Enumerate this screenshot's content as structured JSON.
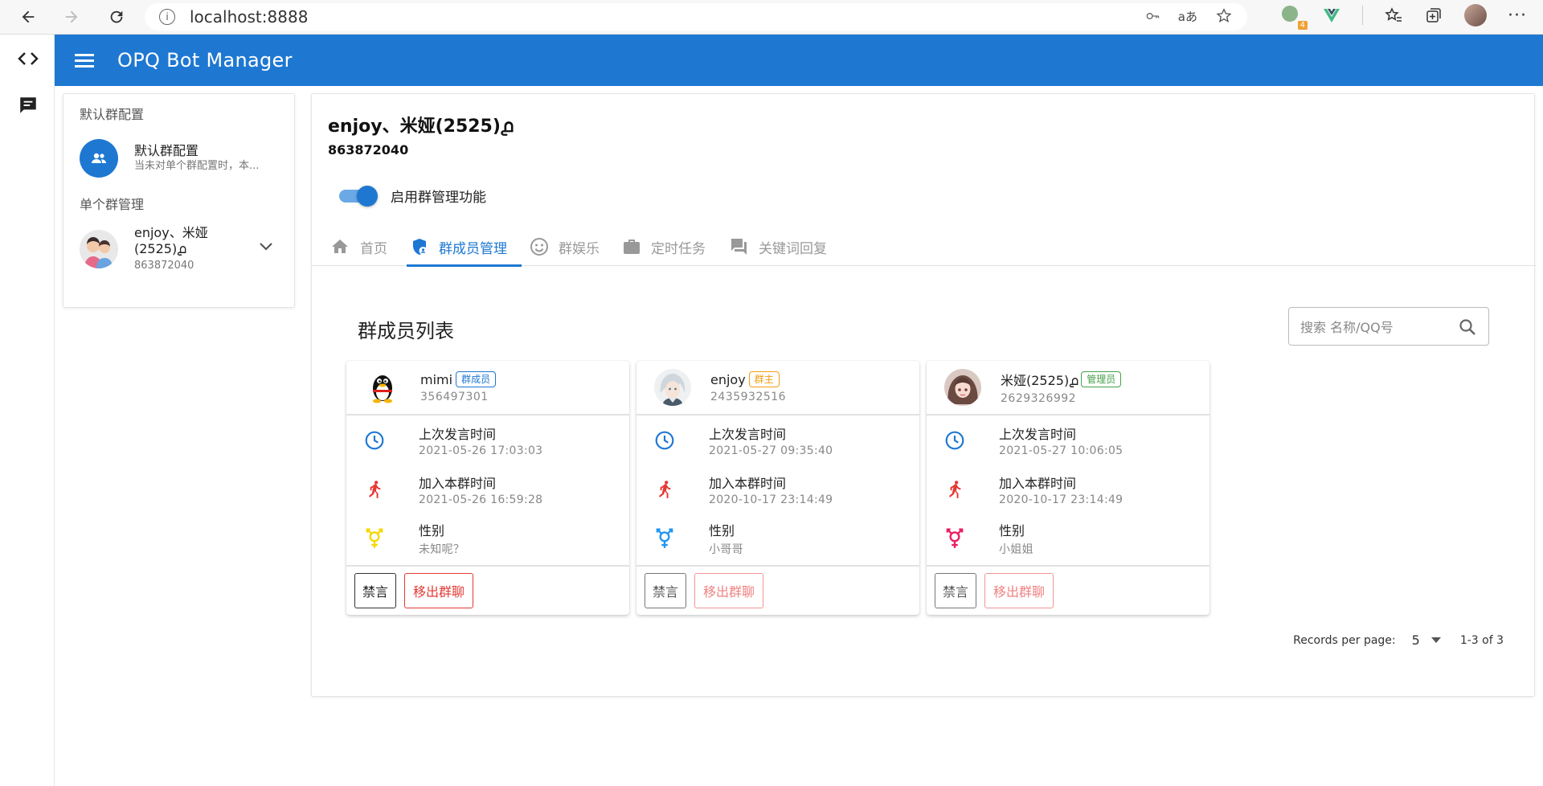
{
  "browser": {
    "url": "localhost:8888",
    "extension_badge": "4"
  },
  "app": {
    "title": "OPQ Bot Manager"
  },
  "sidebar": {
    "default_section": "默认群配置",
    "default_item": {
      "title": "默认群配置",
      "subtitle": "当未对单个群配置时，本..."
    },
    "groups_section": "单个群管理",
    "group_item": {
      "title": "enjoy、米娅(2525)൧",
      "subtitle": "863872040"
    }
  },
  "group": {
    "title": "enjoy、米娅(2525)൧",
    "id": "863872040",
    "switch_label": "启用群管理功能"
  },
  "tabs": [
    {
      "label": "首页"
    },
    {
      "label": "群成员管理"
    },
    {
      "label": "群娱乐"
    },
    {
      "label": "定时任务"
    },
    {
      "label": "关键词回复"
    }
  ],
  "members": {
    "title": "群成员列表",
    "search_placeholder": "搜索 名称/QQ号",
    "labels": {
      "last_msg": "上次发言时间",
      "joined": "加入本群时间",
      "gender": "性别",
      "mute": "禁言",
      "kick": "移出群聊"
    },
    "cards": [
      {
        "name": "mimi",
        "role": "群成员",
        "role_color": "#1e78d2",
        "qq": "356497301",
        "last_msg": "2021-05-26 17:03:03",
        "joined": "2021-05-26 16:59:28",
        "gender": "未知呢？",
        "gender_color": "#f5d800"
      },
      {
        "name": "enjoy",
        "role": "群主",
        "role_color": "#f39c12",
        "qq": "2435932516",
        "last_msg": "2021-05-27 09:35:40",
        "joined": "2020-10-17 23:14:49",
        "gender": "小哥哥",
        "gender_color": "#2196f3"
      },
      {
        "name": "米娅(2525)൧",
        "role": "管理员",
        "role_color": "#43a047",
        "qq": "2629326992",
        "last_msg": "2021-05-27 10:06:05",
        "joined": "2020-10-17 23:14:49",
        "gender": "小姐姐",
        "gender_color": "#e91e63"
      }
    ]
  },
  "pagination": {
    "label": "Records per page:",
    "per_page": "5",
    "range": "1-3 of 3"
  }
}
